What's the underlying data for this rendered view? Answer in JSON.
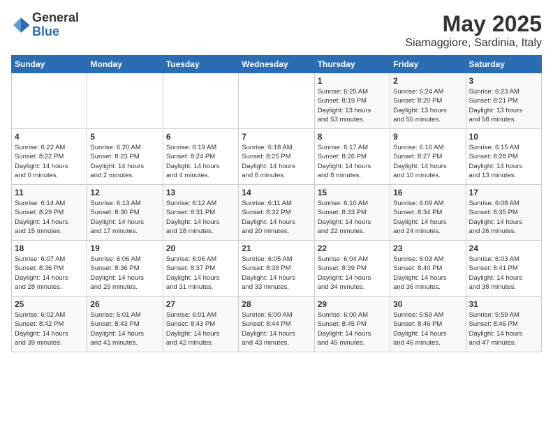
{
  "logo": {
    "general": "General",
    "blue": "Blue"
  },
  "title": "May 2025",
  "location": "Siamaggiore, Sardinia, Italy",
  "days_of_week": [
    "Sunday",
    "Monday",
    "Tuesday",
    "Wednesday",
    "Thursday",
    "Friday",
    "Saturday"
  ],
  "weeks": [
    [
      {
        "day": "",
        "info": ""
      },
      {
        "day": "",
        "info": ""
      },
      {
        "day": "",
        "info": ""
      },
      {
        "day": "",
        "info": ""
      },
      {
        "day": "1",
        "info": "Sunrise: 6:25 AM\nSunset: 8:19 PM\nDaylight: 13 hours\nand 53 minutes."
      },
      {
        "day": "2",
        "info": "Sunrise: 6:24 AM\nSunset: 8:20 PM\nDaylight: 13 hours\nand 55 minutes."
      },
      {
        "day": "3",
        "info": "Sunrise: 6:23 AM\nSunset: 8:21 PM\nDaylight: 13 hours\nand 58 minutes."
      }
    ],
    [
      {
        "day": "4",
        "info": "Sunrise: 6:22 AM\nSunset: 8:22 PM\nDaylight: 14 hours\nand 0 minutes."
      },
      {
        "day": "5",
        "info": "Sunrise: 6:20 AM\nSunset: 8:23 PM\nDaylight: 14 hours\nand 2 minutes."
      },
      {
        "day": "6",
        "info": "Sunrise: 6:19 AM\nSunset: 8:24 PM\nDaylight: 14 hours\nand 4 minutes."
      },
      {
        "day": "7",
        "info": "Sunrise: 6:18 AM\nSunset: 8:25 PM\nDaylight: 14 hours\nand 6 minutes."
      },
      {
        "day": "8",
        "info": "Sunrise: 6:17 AM\nSunset: 8:26 PM\nDaylight: 14 hours\nand 8 minutes."
      },
      {
        "day": "9",
        "info": "Sunrise: 6:16 AM\nSunset: 8:27 PM\nDaylight: 14 hours\nand 10 minutes."
      },
      {
        "day": "10",
        "info": "Sunrise: 6:15 AM\nSunset: 8:28 PM\nDaylight: 14 hours\nand 13 minutes."
      }
    ],
    [
      {
        "day": "11",
        "info": "Sunrise: 6:14 AM\nSunset: 8:29 PM\nDaylight: 14 hours\nand 15 minutes."
      },
      {
        "day": "12",
        "info": "Sunrise: 6:13 AM\nSunset: 8:30 PM\nDaylight: 14 hours\nand 17 minutes."
      },
      {
        "day": "13",
        "info": "Sunrise: 6:12 AM\nSunset: 8:31 PM\nDaylight: 14 hours\nand 18 minutes."
      },
      {
        "day": "14",
        "info": "Sunrise: 6:11 AM\nSunset: 8:32 PM\nDaylight: 14 hours\nand 20 minutes."
      },
      {
        "day": "15",
        "info": "Sunrise: 6:10 AM\nSunset: 8:33 PM\nDaylight: 14 hours\nand 22 minutes."
      },
      {
        "day": "16",
        "info": "Sunrise: 6:09 AM\nSunset: 8:34 PM\nDaylight: 14 hours\nand 24 minutes."
      },
      {
        "day": "17",
        "info": "Sunrise: 6:08 AM\nSunset: 8:35 PM\nDaylight: 14 hours\nand 26 minutes."
      }
    ],
    [
      {
        "day": "18",
        "info": "Sunrise: 6:07 AM\nSunset: 8:36 PM\nDaylight: 14 hours\nand 28 minutes."
      },
      {
        "day": "19",
        "info": "Sunrise: 6:06 AM\nSunset: 8:36 PM\nDaylight: 14 hours\nand 29 minutes."
      },
      {
        "day": "20",
        "info": "Sunrise: 6:06 AM\nSunset: 8:37 PM\nDaylight: 14 hours\nand 31 minutes."
      },
      {
        "day": "21",
        "info": "Sunrise: 6:05 AM\nSunset: 8:38 PM\nDaylight: 14 hours\nand 33 minutes."
      },
      {
        "day": "22",
        "info": "Sunrise: 6:04 AM\nSunset: 8:39 PM\nDaylight: 14 hours\nand 34 minutes."
      },
      {
        "day": "23",
        "info": "Sunrise: 6:03 AM\nSunset: 8:40 PM\nDaylight: 14 hours\nand 36 minutes."
      },
      {
        "day": "24",
        "info": "Sunrise: 6:03 AM\nSunset: 8:41 PM\nDaylight: 14 hours\nand 38 minutes."
      }
    ],
    [
      {
        "day": "25",
        "info": "Sunrise: 6:02 AM\nSunset: 8:42 PM\nDaylight: 14 hours\nand 39 minutes."
      },
      {
        "day": "26",
        "info": "Sunrise: 6:01 AM\nSunset: 8:43 PM\nDaylight: 14 hours\nand 41 minutes."
      },
      {
        "day": "27",
        "info": "Sunrise: 6:01 AM\nSunset: 8:43 PM\nDaylight: 14 hours\nand 42 minutes."
      },
      {
        "day": "28",
        "info": "Sunrise: 6:00 AM\nSunset: 8:44 PM\nDaylight: 14 hours\nand 43 minutes."
      },
      {
        "day": "29",
        "info": "Sunrise: 6:00 AM\nSunset: 8:45 PM\nDaylight: 14 hours\nand 45 minutes."
      },
      {
        "day": "30",
        "info": "Sunrise: 5:59 AM\nSunset: 8:46 PM\nDaylight: 14 hours\nand 46 minutes."
      },
      {
        "day": "31",
        "info": "Sunrise: 5:59 AM\nSunset: 8:46 PM\nDaylight: 14 hours\nand 47 minutes."
      }
    ]
  ]
}
